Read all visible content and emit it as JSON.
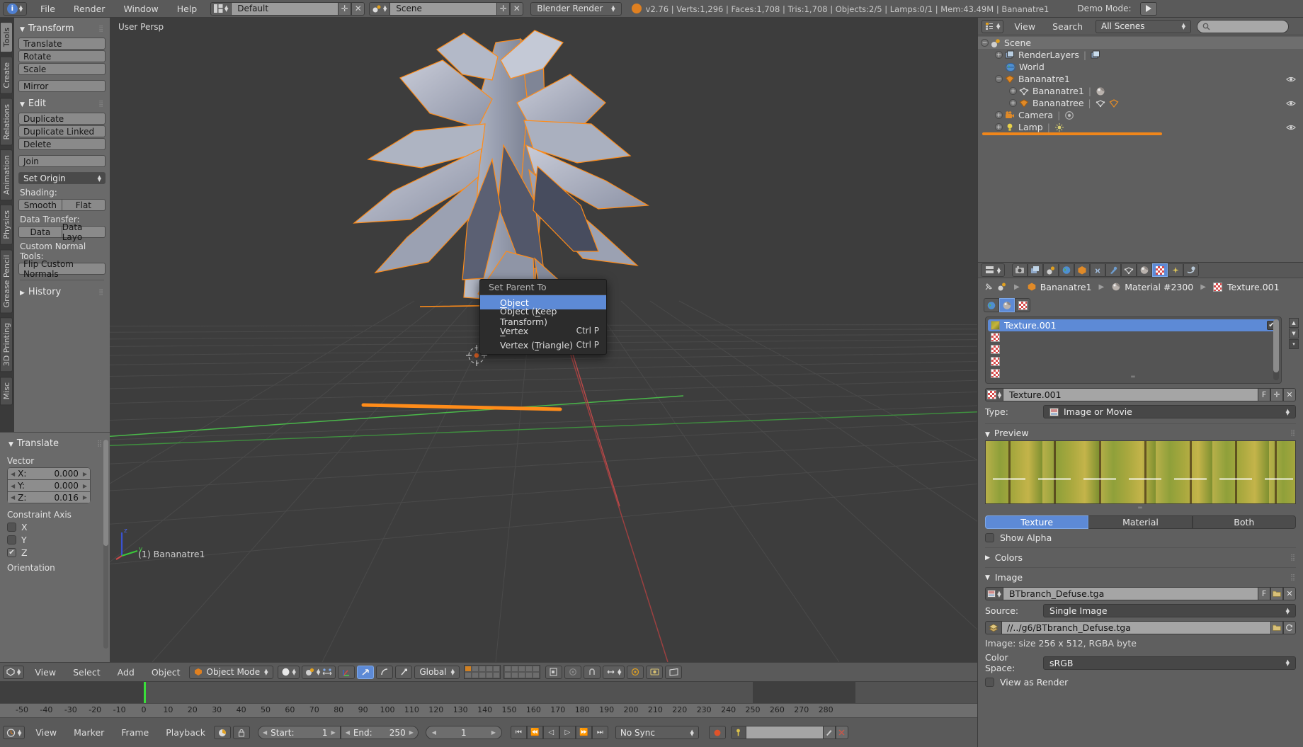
{
  "app": {
    "title": "Blender",
    "version_stats": "v2.76 | Verts:1,296 | Faces:1,708 | Tris:1,708 | Objects:2/5 | Lamps:0/1 | Mem:43.49M | Bananatre1",
    "demo_mode_label": "Demo Mode:"
  },
  "topbar": {
    "menus": [
      "File",
      "Render",
      "Window",
      "Help"
    ],
    "screen_layout": "Default",
    "scene_name": "Scene",
    "render_engine": "Blender Render",
    "icons": {
      "blender_logo": "blender-logo-icon",
      "layout_icon": "screen-layout-icon",
      "scene_icon": "scene-icon",
      "add_icon": "plus-icon",
      "remove_icon": "x-icon",
      "play_icon": "play-icon",
      "info_icon": "blender-info-icon"
    }
  },
  "toolshelf": {
    "tabs": [
      "Tools",
      "Create",
      "Relations",
      "Animation",
      "Physics",
      "Grease Pencil",
      "3D Printing",
      "Misc"
    ],
    "active_tab": "Tools",
    "panels": [
      {
        "name": "Transform",
        "open": true,
        "buttons": [
          "Translate",
          "Rotate",
          "Scale",
          "Mirror"
        ]
      },
      {
        "name": "Edit",
        "open": true,
        "buttons": [
          "Duplicate",
          "Duplicate Linked",
          "Delete",
          "Join"
        ],
        "menu_button": "Set Origin",
        "shading_label": "Shading:",
        "shading_buttons": [
          "Smooth",
          "Flat"
        ],
        "data_transfer_label": "Data Transfer:",
        "data_transfer_buttons": [
          "Data",
          "Data Layo"
        ],
        "custom_normal_label": "Custom Normal Tools:",
        "custom_normal_button": "Flip Custom Normals"
      },
      {
        "name": "History",
        "open": false
      }
    ]
  },
  "operator_panel": {
    "title": "Translate",
    "vector_label": "Vector",
    "fields": [
      {
        "name": "X:",
        "value": "0.000"
      },
      {
        "name": "Y:",
        "value": "0.000"
      },
      {
        "name": "Z:",
        "value": "0.016"
      }
    ],
    "constraint_axis_label": "Constraint Axis",
    "axes": [
      {
        "label": "X",
        "checked": false
      },
      {
        "label": "Y",
        "checked": false
      },
      {
        "label": "Z",
        "checked": true
      }
    ],
    "orientation_label": "Orientation"
  },
  "viewport": {
    "view_label": "User Persp",
    "object_label": "(1) Bananatre1",
    "axis_gizmo": {
      "z": "z",
      "y": "y"
    }
  },
  "context_menu": {
    "title": "Set Parent To",
    "items": [
      {
        "label": "Object",
        "shortcut": "",
        "highlighted": true
      },
      {
        "label": "Object (Keep Transform)",
        "shortcut": "",
        "highlighted": false
      },
      {
        "label": "Vertex",
        "shortcut": "Ctrl P",
        "highlighted": false
      },
      {
        "label": "Vertex (Triangle)",
        "shortcut": "Ctrl P",
        "highlighted": false
      }
    ]
  },
  "viewport_footer": {
    "menus": [
      "View",
      "Select",
      "Add",
      "Object"
    ],
    "mode": "Object Mode",
    "transform_orientation": "Global",
    "icons": {
      "editor_type": "3d-view-icon",
      "shading": "shading-sphere-icon",
      "pivot": "pivot-icon",
      "manipulator": "manipulator-icon",
      "translate_gizmo": "translate-manipulator-icon",
      "rotate_gizmo": "rotate-manipulator-icon",
      "scale_gizmo": "scale-manipulator-icon",
      "snap": "snap-magnet-icon",
      "proportional": "proportional-edit-icon",
      "render_icon": "camera-render-icon"
    }
  },
  "timeline": {
    "menus": [
      "View",
      "Marker",
      "Frame",
      "Playback"
    ],
    "start_label": "Start:",
    "start_value": "1",
    "end_label": "End:",
    "end_value": "250",
    "current_frame": "1",
    "sync_mode": "No Sync",
    "ticks": [
      "-50",
      "-40",
      "-30",
      "-20",
      "-10",
      "0",
      "10",
      "20",
      "30",
      "40",
      "50",
      "60",
      "70",
      "80",
      "90",
      "100",
      "110",
      "120",
      "130",
      "140",
      "150",
      "160",
      "170",
      "180",
      "190",
      "200",
      "210",
      "220",
      "230",
      "240",
      "250",
      "260",
      "270",
      "280"
    ],
    "nav_buttons": [
      "jump-start",
      "prev-keyframe",
      "play-reverse",
      "play",
      "next-keyframe",
      "jump-end"
    ],
    "record_icon": "record-icon",
    "key_icon": "keyframe-icon",
    "pen_icon": "pen-icon",
    "scissors_icon": "scissors-icon"
  },
  "outliner": {
    "menus": [
      "View",
      "Search"
    ],
    "display_mode": "All Scenes",
    "search_placeholder": "",
    "rows": [
      {
        "label": "Scene",
        "indent": 0,
        "icon": "scene-icon",
        "expander": "minus",
        "selected": true,
        "eye": false
      },
      {
        "label": "RenderLayers",
        "indent": 1,
        "icon": "renderlayers-icon",
        "expander": "plus",
        "selected": false,
        "eye": false,
        "extra_icon": "renderlayer-data-icon"
      },
      {
        "label": "World",
        "indent": 1,
        "icon": "world-icon",
        "expander": "none",
        "selected": false,
        "eye": false
      },
      {
        "label": "Bananatre1",
        "indent": 1,
        "icon": "mesh-object-icon",
        "expander": "minus",
        "selected": false,
        "eye": true
      },
      {
        "label": "Bananatre1",
        "indent": 2,
        "icon": "mesh-data-icon",
        "expander": "plus",
        "selected": false,
        "eye": false,
        "extra_icon": "material-icon"
      },
      {
        "label": "Bananatree",
        "indent": 2,
        "icon": "mesh-object-icon",
        "expander": "plus",
        "selected": false,
        "eye": true,
        "extra_icon": "mesh-data-icon"
      },
      {
        "label": "Camera",
        "indent": 1,
        "icon": "camera-icon",
        "expander": "plus",
        "selected": false,
        "eye": true,
        "extra_icon": "camera-data-icon"
      },
      {
        "label": "Lamp",
        "indent": 1,
        "icon": "lamp-icon",
        "expander": "plus",
        "selected": false,
        "eye": true,
        "extra_icon": "lamp-data-icon"
      }
    ]
  },
  "properties": {
    "tabs": [
      "render-icon",
      "renderlayers-icon",
      "scene-icon",
      "world-icon",
      "object-icon",
      "constraints-icon",
      "modifiers-icon",
      "object-data-icon",
      "material-icon",
      "texture-icon",
      "particles-icon",
      "physics-icon"
    ],
    "active_tab": "texture-icon",
    "breadcrumb": [
      "Bananatre1",
      "Material #2300",
      "Texture.001"
    ],
    "context_toggles": [
      "world-texture-icon",
      "material-texture-icon",
      "brush-texture-icon"
    ],
    "active_context_toggle": 1,
    "texture_slots": [
      {
        "label": "Texture.001",
        "selected": true,
        "checked": true
      },
      {
        "label": "",
        "selected": false,
        "checked": false
      },
      {
        "label": "",
        "selected": false,
        "checked": false
      },
      {
        "label": "",
        "selected": false,
        "checked": false
      },
      {
        "label": "",
        "selected": false,
        "checked": false
      }
    ],
    "datablock_name": "Texture.001",
    "fake_user_label": "F",
    "type_label": "Type:",
    "type_value": "Image or Movie",
    "preview_section": "Preview",
    "preview_modes": [
      "Texture",
      "Material",
      "Both"
    ],
    "preview_active": "Texture",
    "show_alpha_label": "Show Alpha",
    "show_alpha_checked": false,
    "colors_section": "Colors",
    "image_section": "Image",
    "image_name": "BTbranch_Defuse.tga",
    "source_label": "Source:",
    "source_value": "Single Image",
    "image_path": "//../g6/BTbranch_Defuse.tga",
    "image_info": "Image: size 256 x 512, RGBA byte",
    "color_space_label": "Color Space:",
    "color_space_value": "sRGB",
    "view_as_render_label": "View as Render",
    "view_as_render_checked": false
  },
  "colors": {
    "accent_blue": "#5d8ad6",
    "accent_orange": "#e08020",
    "header_gray": "#5a5a5a",
    "panel_gray": "#6a6a6a",
    "viewport_bg": "#3d3d3d",
    "selected_outline": "#ff8c19",
    "axis_x": "#d04a4a",
    "axis_y": "#4ad04a",
    "axis_z": "#3a52d0"
  }
}
